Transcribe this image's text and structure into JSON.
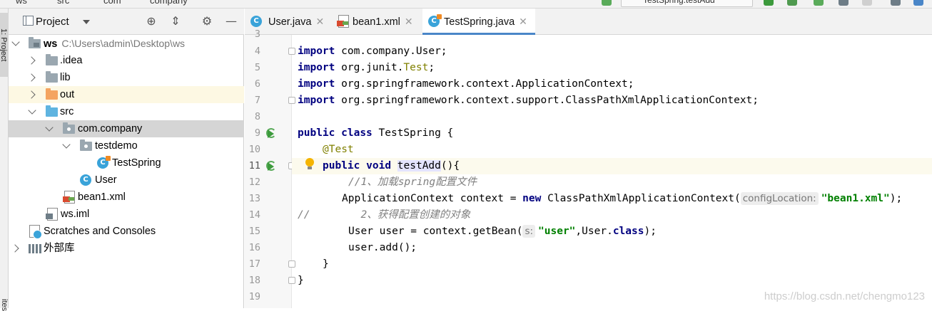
{
  "top_bar": {
    "crumbs": [
      "ws",
      "src",
      "com",
      "company"
    ],
    "run_config": "TestSpring.testAdd"
  },
  "left_strip": {
    "project_tab": "1: Project",
    "favorites_tab": "ites"
  },
  "project_panel": {
    "title": "Project",
    "tools": [
      "target-icon",
      "collapse-icon",
      "gear-icon",
      "minimize-icon"
    ],
    "tree": [
      {
        "label": "ws",
        "path": "C:\\Users\\admin\\Desktop\\ws",
        "icon": "ws-folder-icon"
      },
      {
        "label": ".idea",
        "icon": "folder-icon"
      },
      {
        "label": "lib",
        "icon": "folder-icon"
      },
      {
        "label": "out",
        "icon": "orange-folder-icon"
      },
      {
        "label": "src",
        "icon": "source-folder-icon"
      },
      {
        "label": "com.company",
        "icon": "package-icon"
      },
      {
        "label": "testdemo",
        "icon": "package-icon"
      },
      {
        "label": "TestSpring",
        "icon": "class-icon"
      },
      {
        "label": "User",
        "icon": "class-icon"
      },
      {
        "label": "bean1.xml",
        "icon": "xml-file-icon"
      },
      {
        "label": "ws.iml",
        "icon": "iml-file-icon"
      },
      {
        "label": "Scratches and Consoles",
        "icon": "scratch-icon"
      },
      {
        "label": "外部库",
        "icon": "library-icon"
      }
    ]
  },
  "editor": {
    "tabs": [
      {
        "label": "User.java",
        "active": false
      },
      {
        "label": "bean1.xml",
        "active": false
      },
      {
        "label": "TestSpring.java",
        "active": true
      }
    ],
    "line_numbers": [
      "3",
      "4",
      "5",
      "6",
      "7",
      "8",
      "9",
      "10",
      "11",
      "12",
      "13",
      "14",
      "15",
      "16",
      "17",
      "18",
      "19"
    ],
    "code": {
      "l4_kw": "import",
      "l4_rest": " com.company.User;",
      "l5_kw": "import",
      "l5_rest1": " org.junit.",
      "l5_ann": "Test",
      "l5_rest2": ";",
      "l6_kw": "import",
      "l6_rest": " org.springframework.context.ApplicationContext;",
      "l7_kw": "import",
      "l7_rest": " org.springframework.context.support.ClassPathXmlApplicationContext;",
      "l9_kw1": "public",
      "l9_kw2": "class",
      "l9_rest": " TestSpring {",
      "l10_ann": "@Test",
      "l11_kw1": "public",
      "l11_kw2": "void",
      "l11_method": "testAdd",
      "l11_rest": "(){",
      "l12_comment": "//1、加载spring配置文件",
      "l13_pre": "ApplicationContext context = ",
      "l13_kw": "new",
      "l13_cls": " ClassPathXmlApplicationContext(",
      "l13_hint": "configLocation:",
      "l13_str": "\"bean1.xml\"",
      "l13_end": ");",
      "l14_comment1": "//",
      "l14_comment2": "2、获得配置创建的对象",
      "l15_pre": "User user = context.getBean(",
      "l15_hint": "s:",
      "l15_str": "\"user\"",
      "l15_mid": ",User.",
      "l15_kw": "class",
      "l15_end": ");",
      "l16_text": "user.add();",
      "l17_text": "}",
      "l18_text": "}"
    },
    "watermark": "https://blog.csdn.net/chengmo123"
  },
  "colors": {
    "keyword": "#000080",
    "annotation": "#808000",
    "string": "#008000",
    "comment": "#808080",
    "accent": "#4a86c8"
  }
}
